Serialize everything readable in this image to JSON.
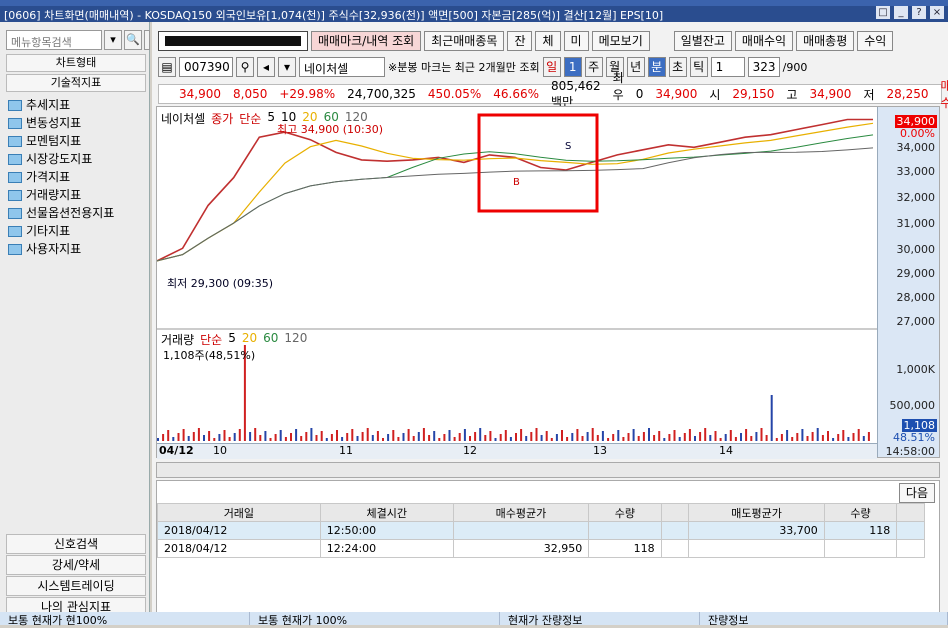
{
  "window": {
    "title": "[0606] 차트화면(매매내역) - KOSDAQ150 외국인보유[1,074(천)] 주식수[32,936(천)] 액면[500] 자본금[285(억)] 결산[12월] EPS[10]",
    "buttons": [
      "□",
      "_",
      "?",
      "×"
    ]
  },
  "left": {
    "search_placeholder": "메뉴항목검색",
    "chart_type_tab": "차트형태",
    "tech_tab": "기술적지표",
    "tree": [
      "추세지표",
      "변동성지표",
      "모멘텀지표",
      "시장강도지표",
      "가격지표",
      "거래량지표",
      "선물옵션전용지표",
      "기타지표",
      "사용자지표"
    ],
    "bottom": [
      "신호검색",
      "강세/약세",
      "시스템트레이딩",
      "나의 관심지표"
    ]
  },
  "toolbar1": {
    "trade_mark": "매매마크/내역 조회",
    "recent": "최근매매종목",
    "jan": "잔",
    "che": "체",
    "mi": "미",
    "memo": "메모보기",
    "daily": "일별잔고",
    "profit": "매매수익",
    "total": "매매총평",
    "suik": "수익"
  },
  "toolbar2": {
    "code": "007390",
    "stock_name": "네이처셀",
    "note": "※분봉 마크는 최근 2개월만 조회",
    "periods": [
      "일",
      "1",
      "주",
      "월",
      "년",
      "분",
      "초",
      "틱"
    ],
    "interval": "1",
    "count": "323",
    "count_total": "/900"
  },
  "quote": {
    "price": "34,900",
    "change": "8,050",
    "rate": "+29.98%",
    "volume": "24,700,325",
    "turnover_pct": "450.05%",
    "pct2": "46.66%",
    "amount": "805,462백만",
    "best": "최우선",
    "zero": "0",
    "p2": "34,900",
    "open_l": "시",
    "open": "29,150",
    "high_l": "고",
    "high": "34,900",
    "low_l": "저",
    "low": "28,250",
    "side": "매수"
  },
  "price_chart": {
    "legend": [
      "네이처셀",
      "종가",
      "단순",
      "5",
      "10",
      "20",
      "60",
      "120"
    ],
    "max_label": "최고 34,900 (10:30)",
    "min_label": "최저 29,300 (09:35)",
    "y_ticks": [
      "34,000",
      "33,000",
      "32,000",
      "31,000",
      "30,000",
      "29,000",
      "28,000",
      "27,000"
    ],
    "last_price": "34,900",
    "last_pct": "0.00%",
    "buy_mark": "B",
    "sell_mark": "S"
  },
  "vol_chart": {
    "legend": [
      "거래량",
      "단순",
      "5",
      "20",
      "60",
      "120"
    ],
    "note": "1,108주(48,51%)",
    "y_ticks": [
      "1,000K",
      "500,000"
    ],
    "last": "1,108",
    "last_pct": "48.51%"
  },
  "x_axis": {
    "labels": [
      "04/12",
      "10",
      "11",
      "12",
      "13",
      "14"
    ],
    "time": "14:58:00"
  },
  "grid": {
    "next": "다음",
    "headers": [
      "거래일",
      "체결시간",
      "매수평균가",
      "수량",
      "",
      "매도평균가",
      "수량",
      ""
    ],
    "rows": [
      [
        "2018/04/12",
        "12:50:00",
        "",
        "",
        "",
        "33,700",
        "118",
        ""
      ],
      [
        "2018/04/12",
        "12:24:00",
        "32,950",
        "118",
        "",
        "",
        "",
        ""
      ]
    ]
  },
  "status": [
    "보통 현재가 현100%",
    "보통 현재가 100%",
    "현재가 잔량정보",
    "잔량정보"
  ],
  "chart_data": {
    "type": "line",
    "series": [
      {
        "name": "종가",
        "values": [
          29300,
          29800,
          31500,
          32600,
          34200,
          34400,
          34100,
          33600,
          33300,
          33250,
          33300,
          33400,
          33200,
          33500,
          33400,
          33000,
          32900,
          33200,
          33500,
          33700,
          33900,
          33800,
          34000,
          34200,
          34300,
          34500,
          34700,
          34900,
          34900
        ]
      }
    ],
    "ylim": [
      27000,
      35000
    ]
  }
}
